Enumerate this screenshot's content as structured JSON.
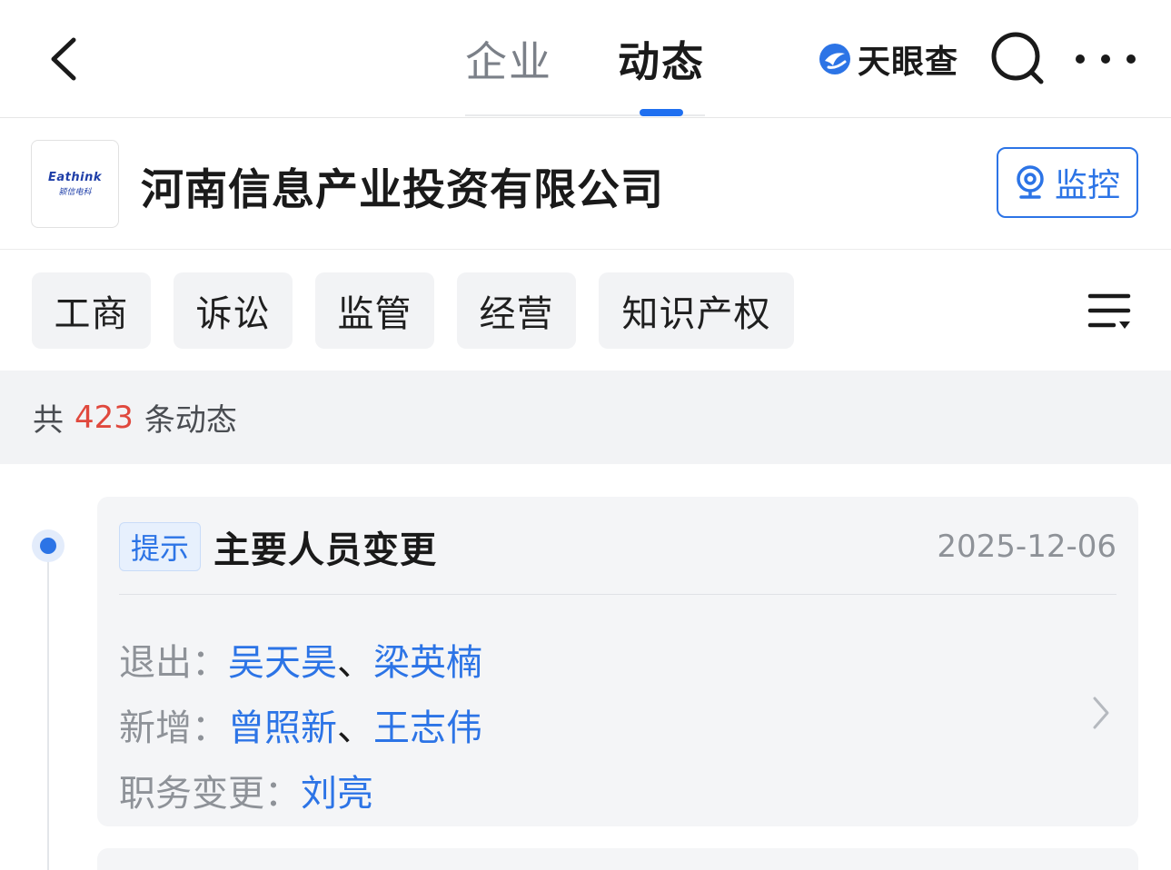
{
  "nav": {
    "tabs": [
      {
        "label": "企业",
        "active": false
      },
      {
        "label": "动态",
        "active": true
      }
    ],
    "brand": "天眼查",
    "accent_color": "#1f6ff0"
  },
  "company": {
    "name": "河南信息产业投资有限公司",
    "logo_text_en": "Eathink",
    "logo_text_cn": "颍信电科",
    "monitor_label": "监控"
  },
  "filters": {
    "chips": [
      "工商",
      "诉讼",
      "监管",
      "经营",
      "知识产权"
    ]
  },
  "summary": {
    "prefix": "共",
    "count": "423",
    "suffix": "条动态",
    "count_color": "#e0483d"
  },
  "events": [
    {
      "tag": "提示",
      "title": "主要人员变更",
      "date": "2025-12-06",
      "details": [
        {
          "label": "退出：",
          "values": [
            "吴天昊",
            "梁英楠"
          ]
        },
        {
          "label": "新增：",
          "values": [
            "曾照新",
            "王志伟"
          ]
        },
        {
          "label": "职务变更：",
          "values": [
            "刘亮"
          ]
        }
      ]
    }
  ]
}
